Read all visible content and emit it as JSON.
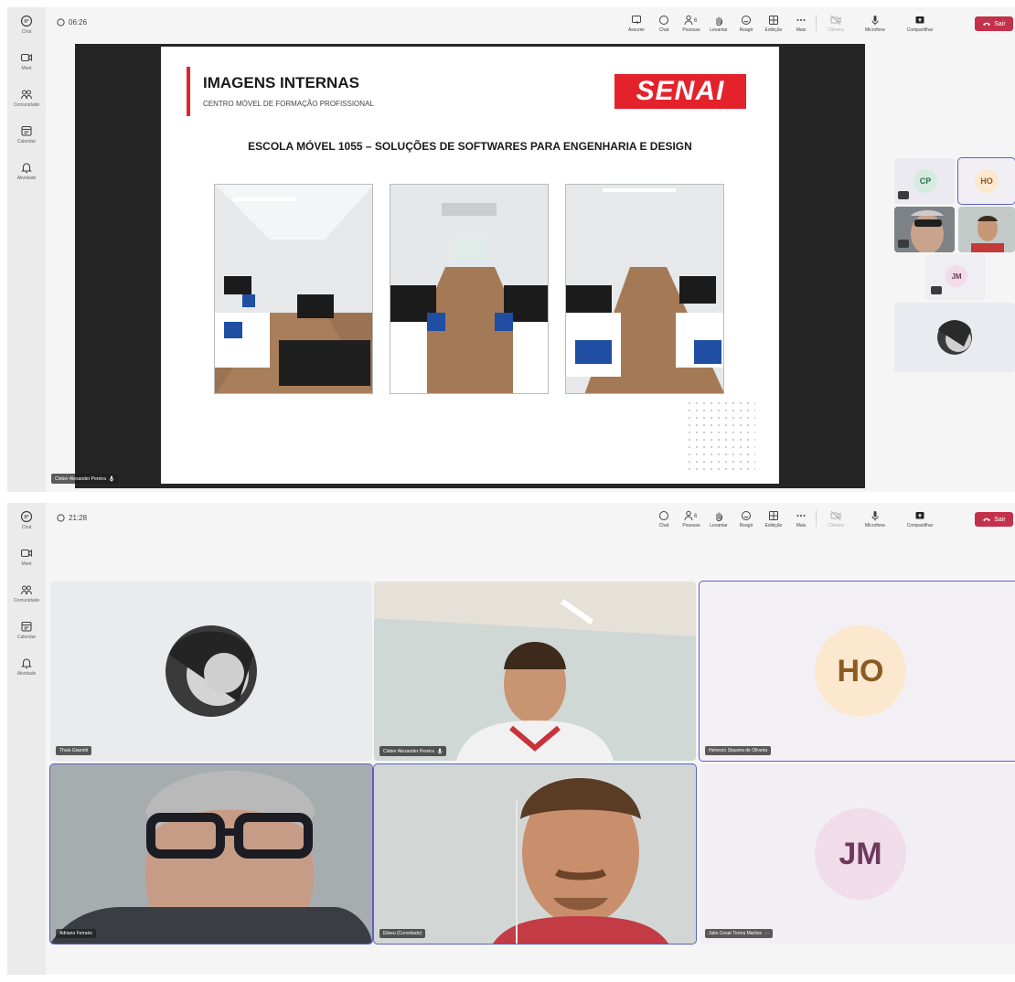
{
  "rail_items": [
    "Chat",
    "Meet",
    "Comunidade",
    "Calendar",
    "Atividade"
  ],
  "top": {
    "timer": "06:26",
    "items": [
      {
        "label": "Assumir",
        "icon": "take-control-icon"
      },
      {
        "label": "Chat",
        "icon": "chat-icon"
      },
      {
        "label": "Pessoas",
        "icon": "people-icon",
        "badge": "6"
      },
      {
        "label": "Levantar",
        "icon": "raise-hand-icon"
      },
      {
        "label": "Reagir",
        "icon": "react-icon"
      },
      {
        "label": "Exibição",
        "icon": "view-icon"
      },
      {
        "label": "Mais",
        "icon": "more-icon"
      },
      {
        "label": "Câmera",
        "icon": "camera-icon"
      },
      {
        "label": "Microfone",
        "icon": "microphone-icon"
      },
      {
        "label": "Compartilhar",
        "icon": "share-icon"
      }
    ],
    "leave_label": "Sair"
  },
  "slide": {
    "title": "IMAGENS INTERNAS",
    "subtitle": "CENTRO MÓVEL DE FORMAÇÃO PROFISSIONAL",
    "logo": "SENAI",
    "heading": "ESCOLA MÓVEL 1055 – SOLUÇÕES DE SOFTWARES PARA ENGENHARIA E DESIGN"
  },
  "presenter_tag": "Cleber Alexander Pereira",
  "gallery": {
    "cp": "CP",
    "ho": "HO",
    "jm": "JM"
  },
  "bottom": {
    "timer": "21:28",
    "participants": [
      {
        "name": "Thaís Gianotti"
      },
      {
        "name": "Cleber Alexander Pereira"
      },
      {
        "name": "Helvecio Siqueira de Oliveira",
        "initials": "HO"
      },
      {
        "name": "Adriano Ferraris"
      },
      {
        "name": "Eliseu (Convidado)"
      },
      {
        "name": "Julio Cesar Torres Martins",
        "initials": "JM",
        "more": "···"
      }
    ]
  },
  "colors": {
    "leave": "#c4314b",
    "accent": "#5b5fc7",
    "senai_red": "#e4222c"
  }
}
